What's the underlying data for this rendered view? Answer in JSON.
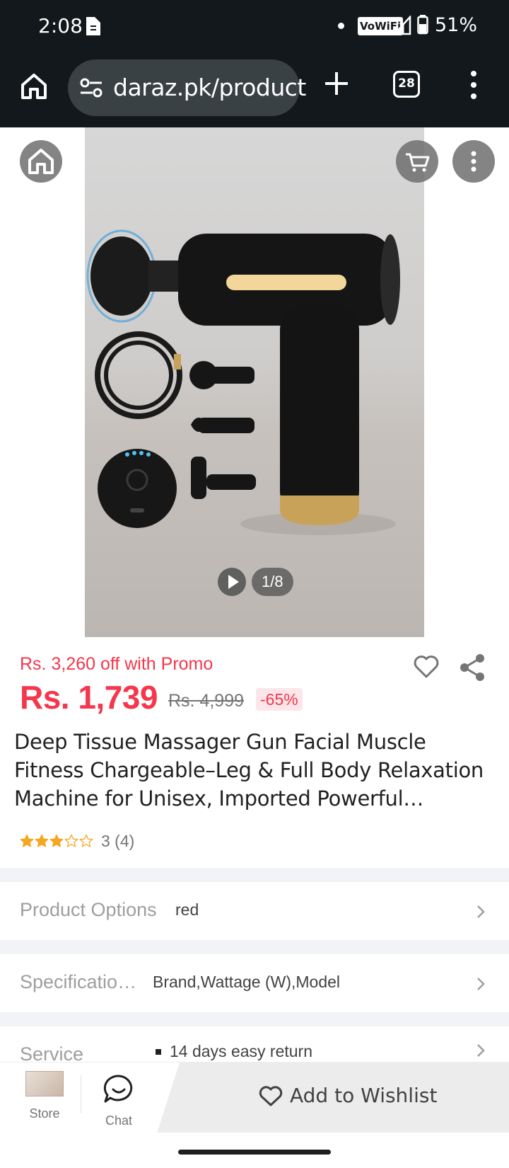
{
  "status_bar": {
    "time": "2:08",
    "network": "VoWiFi",
    "battery": "51%"
  },
  "browser": {
    "url": "daraz.pk/product",
    "tab_count": "28"
  },
  "gallery": {
    "page_indicator": "1/8",
    "icons": [
      "home-icon",
      "cart-icon",
      "more-vertical-icon",
      "play-icon"
    ]
  },
  "product": {
    "promo_text": "Rs. 3,260 off with Promo",
    "price": "Rs. 1,739",
    "original_price": "Rs. 4,999",
    "discount": "-65%",
    "title": "Deep Tissue Massager Gun Facial Muscle Fitness Chargeable–Leg & Full Body Relaxation Machine for Unisex, Imported Powerful…",
    "rating_value": 3,
    "rating_max": 5,
    "rating_text": "3 (4)"
  },
  "details": {
    "options": {
      "label": "Product Options",
      "value": "red"
    },
    "specifications": {
      "label": "Specificatio…",
      "value": "Brand,Wattage (W),Model"
    },
    "service": {
      "label": "Service",
      "value": "14 days easy return"
    }
  },
  "bottom_bar": {
    "store_label": "Store",
    "chat_label": "Chat",
    "wishlist_label": "Add to Wishlist"
  },
  "colors": {
    "accent": "#f5364c",
    "chrome_bg": "#12181b",
    "star": "#f5a623"
  }
}
